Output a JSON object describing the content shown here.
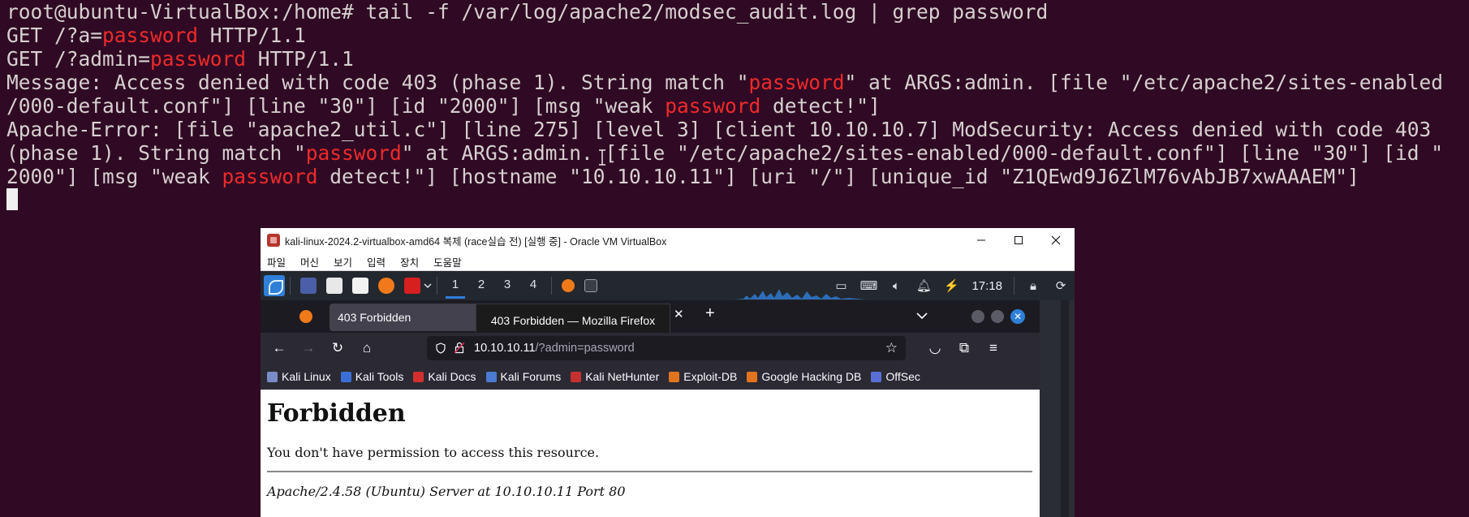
{
  "terminal": {
    "prompt_line": "root@ubuntu-VirtualBox:/home# tail -f /var/log/apache2/modsec_audit.log | grep password",
    "highlight": "password",
    "l2a": "GET /?a=",
    "l2b": " HTTP/1.1",
    "l3a": "GET /?admin=",
    "l3b": " HTTP/1.1",
    "l4a": "Message: Access denied with code 403 (phase 1). String match \"",
    "l4b": "\" at ARGS:admin. [file \"/etc/apache2/sites-enabled",
    "l5a": "/000-default.conf\"] [line \"30\"] [id \"2000\"] [msg \"weak ",
    "l5b": " detect!\"]",
    "l6": "Apache-Error: [file \"apache2_util.c\"] [line 275] [level 3] [client 10.10.10.7] ModSecurity: Access denied with code 403",
    "l7a": "(phase 1). String match \"",
    "l7b": "\" at ARGS:admin. [file \"/etc/apache2/sites-enabled/000-default.conf\"] [line \"30\"] [id \"",
    "l8a": "2000\"] [msg \"weak ",
    "l8b": " detect!\"] [hostname \"10.10.10.11\"] [uri \"/\"] [unique_id \"Z1QEwd9J6ZlM76vAbJB7xwAAAEM\"]"
  },
  "vbox": {
    "title": "kali-linux-2024.2-virtualbox-amd64 복제 (race실습 전) [실행 중] - Oracle VM VirtualBox",
    "menu": [
      "파일",
      "머신",
      "보기",
      "입력",
      "장치",
      "도움말"
    ]
  },
  "kali_panel": {
    "workspaces": [
      "1",
      "2",
      "3",
      "4"
    ],
    "clock": "17:18"
  },
  "firefox": {
    "tab_title": "403 Forbidden",
    "tooltip": "403 Forbidden — Mozilla Firefox",
    "url_host": "10.10.10.11",
    "url_path": "/?admin=password",
    "bookmarks": [
      "Kali Linux",
      "Kali Tools",
      "Kali Docs",
      "Kali Forums",
      "Kali NetHunter",
      "Exploit-DB",
      "Google Hacking DB",
      "OffSec"
    ],
    "page": {
      "heading": "Forbidden",
      "message": "You don't have permission to access this resource.",
      "address": "Apache/2.4.58 (Ubuntu) Server at 10.10.10.11 Port 80"
    }
  },
  "colors": {
    "terminal_bg": "#300a24",
    "terminal_fg": "#d6d0cf",
    "highlight": "#ef2a2a"
  }
}
